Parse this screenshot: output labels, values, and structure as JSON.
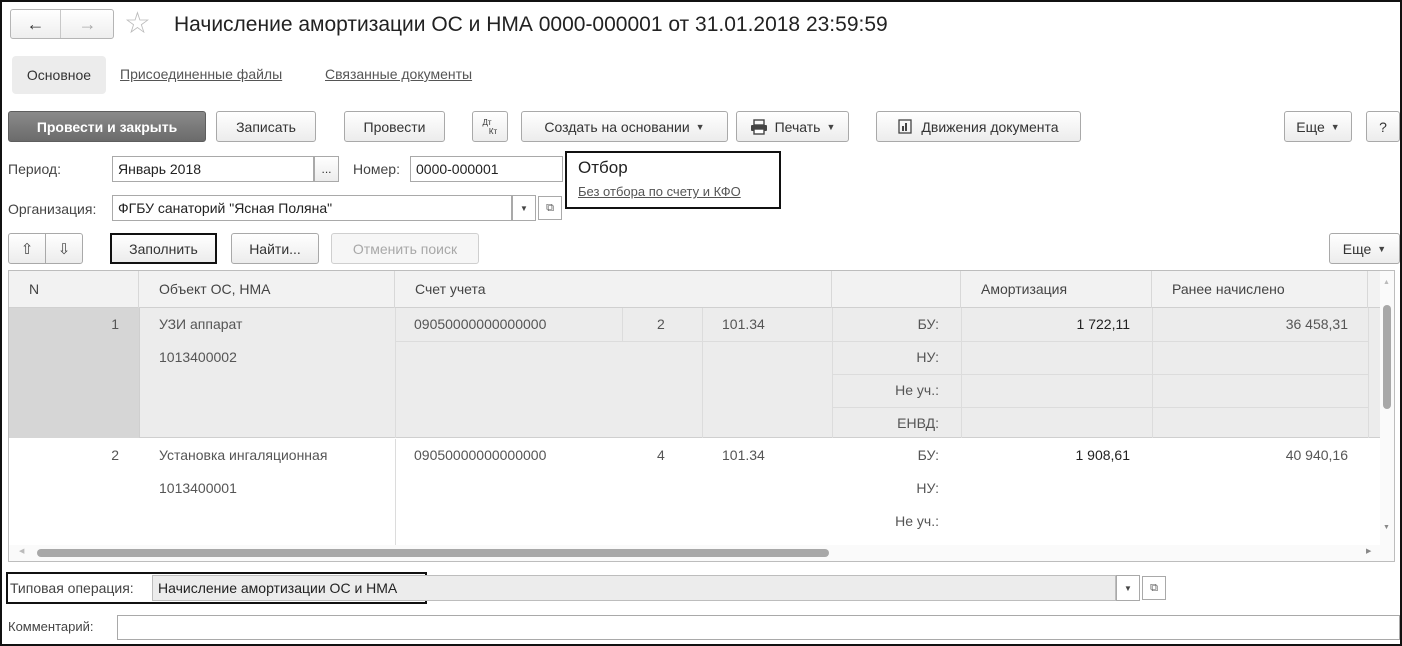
{
  "window": {
    "title": "Начисление амортизации ОС и НМА 0000-000001 от 31.01.2018 23:59:59"
  },
  "tabs": [
    "Основное",
    "Присоединенные файлы",
    "Связанные документы"
  ],
  "toolbar": {
    "post_close": "Провести и закрыть",
    "save": "Записать",
    "post": "Провести",
    "dtkt_top": "Дт",
    "dtkt_bottom": "Кт",
    "create_based": "Создать на основании",
    "print": "Печать",
    "movements": "Движения документа",
    "more": "Еще",
    "help": "?"
  },
  "form": {
    "period_label": "Период:",
    "period_value": "Январь 2018",
    "period_btn": "...",
    "number_label": "Номер:",
    "number_value": "0000-000001",
    "org_label": "Организация:",
    "org_value": "ФГБУ санаторий \"Ясная Поляна\"",
    "filter_title": "Отбор",
    "filter_link": "Без отбора по счету и КФО"
  },
  "table_toolbar": {
    "fill": "Заполнить",
    "find": "Найти...",
    "cancel_search": "Отменить поиск",
    "more": "Еще"
  },
  "table": {
    "columns": [
      "N",
      "Объект ОС, НМА",
      "Счет учета",
      "",
      "Амортизация",
      "Ранее начислено"
    ],
    "rows": [
      {
        "n": "1",
        "object": "УЗИ аппарат",
        "inv": "1013400002",
        "account": "09050000000000000",
        "kfo": "2",
        "subaccount": "101.34",
        "types": [
          "БУ:",
          "НУ:",
          "Не уч.:",
          "ЕНВД:"
        ],
        "amort": "1 722,11",
        "prev": "36 458,31"
      },
      {
        "n": "2",
        "object": "Установка ингаляционная",
        "inv": "1013400001",
        "account": "09050000000000000",
        "kfo": "4",
        "subaccount": "101.34",
        "types": [
          "БУ:",
          "НУ:",
          "Не уч.:"
        ],
        "amort": "1 908,61",
        "prev": "40 940,16"
      }
    ]
  },
  "footer": {
    "operation_label": "Типовая операция:",
    "operation_value": "Начисление амортизации ОС и НМА",
    "comment_label": "Комментарий:",
    "comment_value": ""
  }
}
